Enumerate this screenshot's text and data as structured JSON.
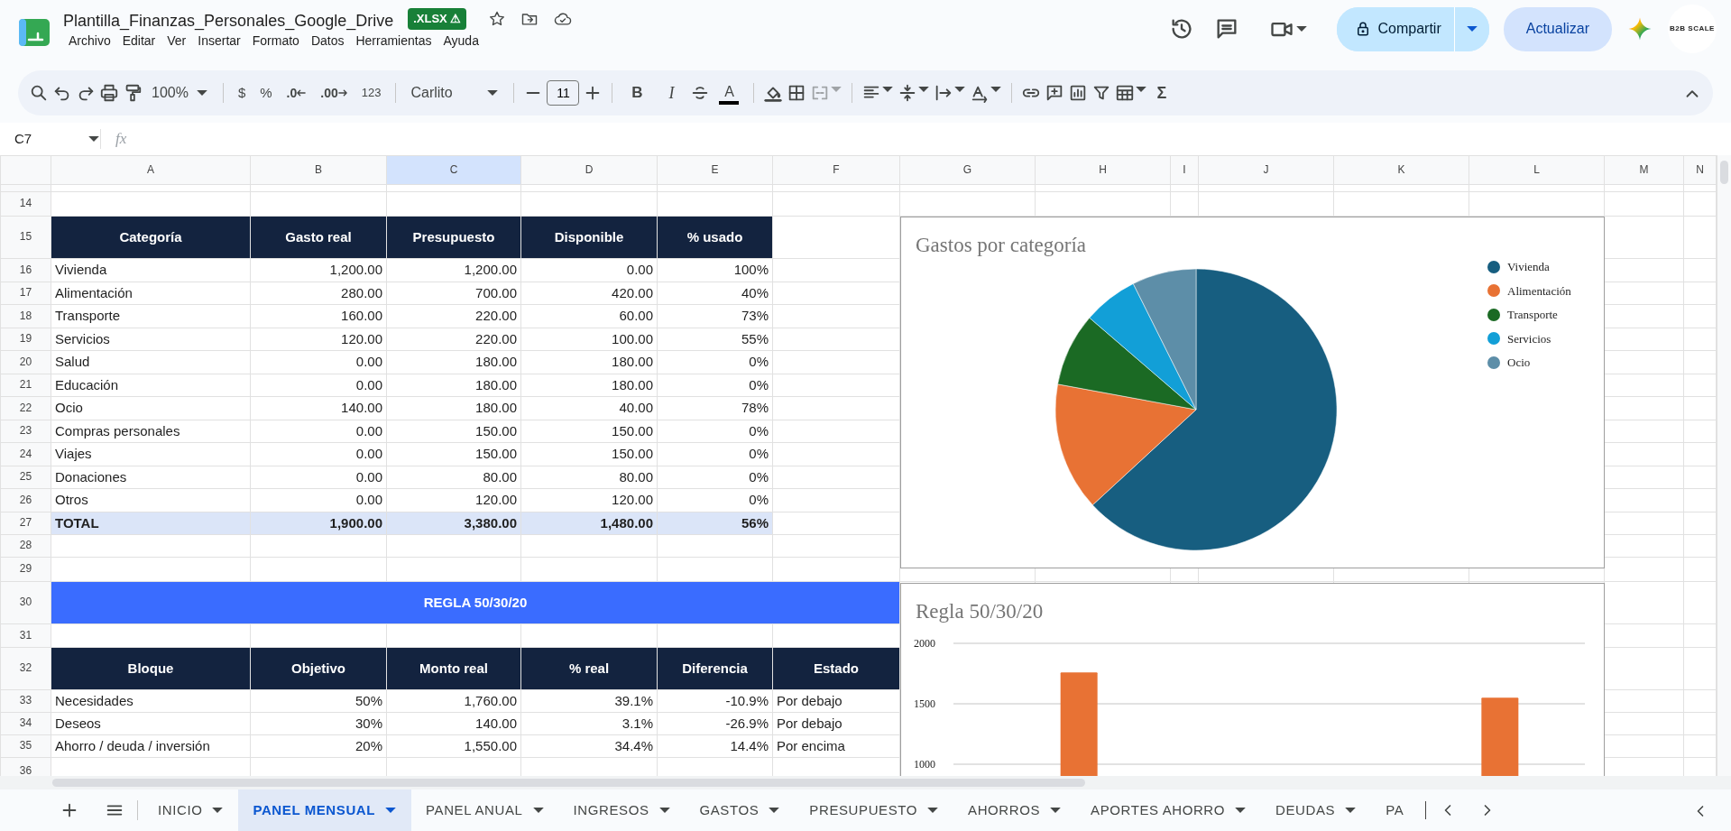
{
  "document": {
    "title": "Plantilla_Finanzas_Personales_Google_Drive",
    "badge": ".XLSX ⚠"
  },
  "menu": [
    "Archivo",
    "Editar",
    "Ver",
    "Insertar",
    "Formato",
    "Datos",
    "Herramientas",
    "Ayuda"
  ],
  "header_actions": {
    "share_label": "Compartir",
    "update_label": "Actualizar",
    "avatar_text": "B2B SCALE"
  },
  "toolbar": {
    "zoom": "100%",
    "currency": "$",
    "percent": "%",
    "decimals_less": ".0",
    "decimals_more": ".00",
    "number_format": "123",
    "font": "Carlito",
    "font_size": "11",
    "bold": "B",
    "italic": "I",
    "text_color": "A",
    "sum": "Σ"
  },
  "formula_bar": {
    "cell_ref": "C7",
    "fx": "fx"
  },
  "columns": [
    {
      "label": "A",
      "selected": false
    },
    {
      "label": "B",
      "selected": false
    },
    {
      "label": "C",
      "selected": true
    },
    {
      "label": "D",
      "selected": false
    },
    {
      "label": "E",
      "selected": false
    },
    {
      "label": "F",
      "selected": false
    },
    {
      "label": "G",
      "selected": false
    },
    {
      "label": "H",
      "selected": false
    },
    {
      "label": "I",
      "selected": false
    },
    {
      "label": "J",
      "selected": false
    },
    {
      "label": "K",
      "selected": false
    },
    {
      "label": "L",
      "selected": false
    },
    {
      "label": "M",
      "selected": false
    },
    {
      "label": "N",
      "selected": false
    }
  ],
  "row_numbers": [
    "14",
    "15",
    "16",
    "17",
    "18",
    "19",
    "20",
    "21",
    "22",
    "23",
    "24",
    "25",
    "26",
    "27",
    "28",
    "29",
    "30",
    "31",
    "32",
    "33",
    "34",
    "35",
    "36"
  ],
  "category_table": {
    "columns": [
      "Categoría",
      "Gasto real",
      "Presupuesto",
      "Disponible",
      "% usado"
    ],
    "rows": [
      [
        "Vivienda",
        "1,200.00",
        "1,200.00",
        "0.00",
        "100%"
      ],
      [
        "Alimentación",
        "280.00",
        "700.00",
        "420.00",
        "40%"
      ],
      [
        "Transporte",
        "160.00",
        "220.00",
        "60.00",
        "73%"
      ],
      [
        "Servicios",
        "120.00",
        "220.00",
        "100.00",
        "55%"
      ],
      [
        "Salud",
        "0.00",
        "180.00",
        "180.00",
        "0%"
      ],
      [
        "Educación",
        "0.00",
        "180.00",
        "180.00",
        "0%"
      ],
      [
        "Ocio",
        "140.00",
        "180.00",
        "40.00",
        "78%"
      ],
      [
        "Compras personales",
        "0.00",
        "150.00",
        "150.00",
        "0%"
      ],
      [
        "Viajes",
        "0.00",
        "150.00",
        "150.00",
        "0%"
      ],
      [
        "Donaciones",
        "0.00",
        "80.00",
        "80.00",
        "0%"
      ],
      [
        "Otros",
        "0.00",
        "120.00",
        "120.00",
        "0%"
      ]
    ],
    "total": [
      "TOTAL",
      "1,900.00",
      "3,380.00",
      "1,480.00",
      "56%"
    ]
  },
  "rule_banner": "REGLA 50/30/20",
  "rule_table": {
    "columns": [
      "Bloque",
      "Objetivo",
      "Monto real",
      "% real",
      "Diferencia",
      "Estado"
    ],
    "rows": [
      [
        "Necesidades",
        "50%",
        "1,760.00",
        "39.1%",
        "-10.9%",
        "Por debajo"
      ],
      [
        "Deseos",
        "30%",
        "140.00",
        "3.1%",
        "-26.9%",
        "Por debajo"
      ],
      [
        "Ahorro / deuda / inversión",
        "20%",
        "1,550.00",
        "34.4%",
        "14.4%",
        "Por encima"
      ]
    ]
  },
  "pie_chart": {
    "legend": [
      {
        "color": "#175e80"
      },
      {
        "color": "#e87234"
      },
      {
        "color": "#1b6a24"
      },
      {
        "color": "#129fd7"
      },
      {
        "color": "#5d8ea8"
      }
    ],
    "chart_data": {
      "type": "pie",
      "title": "Gastos por categoría",
      "categories": [
        "Vivienda",
        "Alimentación",
        "Transporte",
        "Servicios",
        "Ocio"
      ],
      "values": [
        63.15,
        14.74,
        8.42,
        6.32,
        7.37
      ]
    }
  },
  "bar_chart": {
    "chart_data": {
      "type": "bar",
      "title": "Regla 50/30/20",
      "ylim": [
        0,
        2000
      ],
      "yticks": [
        1000,
        1500,
        2000
      ],
      "series": [
        {
          "color": "#e87234",
          "values": [
            1760,
            null,
            1550
          ]
        }
      ]
    }
  },
  "sheet_tabs": [
    {
      "label": "INICIO",
      "selected": false
    },
    {
      "label": "PANEL MENSUAL",
      "selected": true
    },
    {
      "label": "PANEL ANUAL",
      "selected": false
    },
    {
      "label": "INGRESOS",
      "selected": false
    },
    {
      "label": "GASTOS",
      "selected": false
    },
    {
      "label": "PRESUPUESTO",
      "selected": false
    },
    {
      "label": "AHORROS",
      "selected": false
    },
    {
      "label": "APORTES AHORRO",
      "selected": false
    },
    {
      "label": "DEUDAS",
      "selected": false
    },
    {
      "label": "PA",
      "selected": false
    }
  ]
}
